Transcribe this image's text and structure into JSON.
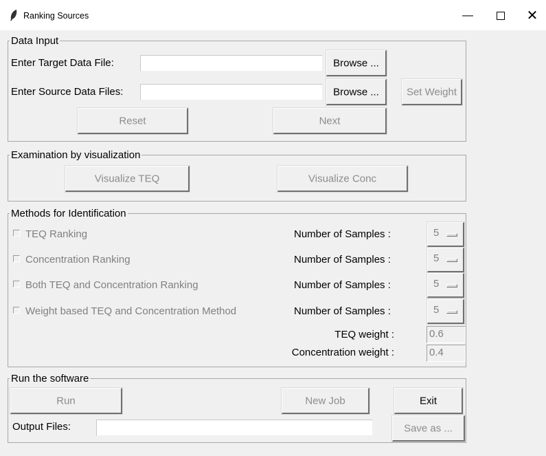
{
  "window": {
    "title": "Ranking Sources",
    "minimize_glyph": "—",
    "close_glyph": "✕"
  },
  "data_input": {
    "frame_label": "Data Input",
    "target_label": "Enter Target Data File:",
    "target_value": "",
    "source_label": "Enter Source Data Files:",
    "source_value": "",
    "browse_target": "Browse ...",
    "browse_source": "Browse ...",
    "set_weight": "Set Weight",
    "reset": "Reset",
    "next": "Next"
  },
  "visualization": {
    "frame_label": "Examination by visualization",
    "visualize_teq": "Visualize TEQ",
    "visualize_conc": "Visualize Conc"
  },
  "methods": {
    "frame_label": "Methods for Identification",
    "rows": [
      {
        "label": "TEQ Ranking",
        "samples_label": "Number of Samples :",
        "samples_value": "5"
      },
      {
        "label": "Concentration Ranking",
        "samples_label": "Number of Samples :",
        "samples_value": "5"
      },
      {
        "label": "Both TEQ and Concentration Ranking",
        "samples_label": "Number of Samples :",
        "samples_value": "5"
      },
      {
        "label": "Weight based TEQ and Concentration Method",
        "samples_label": "Number of Samples :",
        "samples_value": "5"
      }
    ],
    "teq_weight_label": "TEQ weight :",
    "teq_weight_value": "0.6",
    "conc_weight_label": "Concentration weight :",
    "conc_weight_value": "0.4"
  },
  "run": {
    "frame_label": "Run the software",
    "run": "Run",
    "new_job": "New Job",
    "exit": "Exit",
    "output_label": "Output Files:",
    "output_value": "",
    "save_as": "Save as ..."
  },
  "colors": {
    "background": "#f0f0f0",
    "disabled_text": "#8c8c8c",
    "titlebar": "#ffffff"
  }
}
